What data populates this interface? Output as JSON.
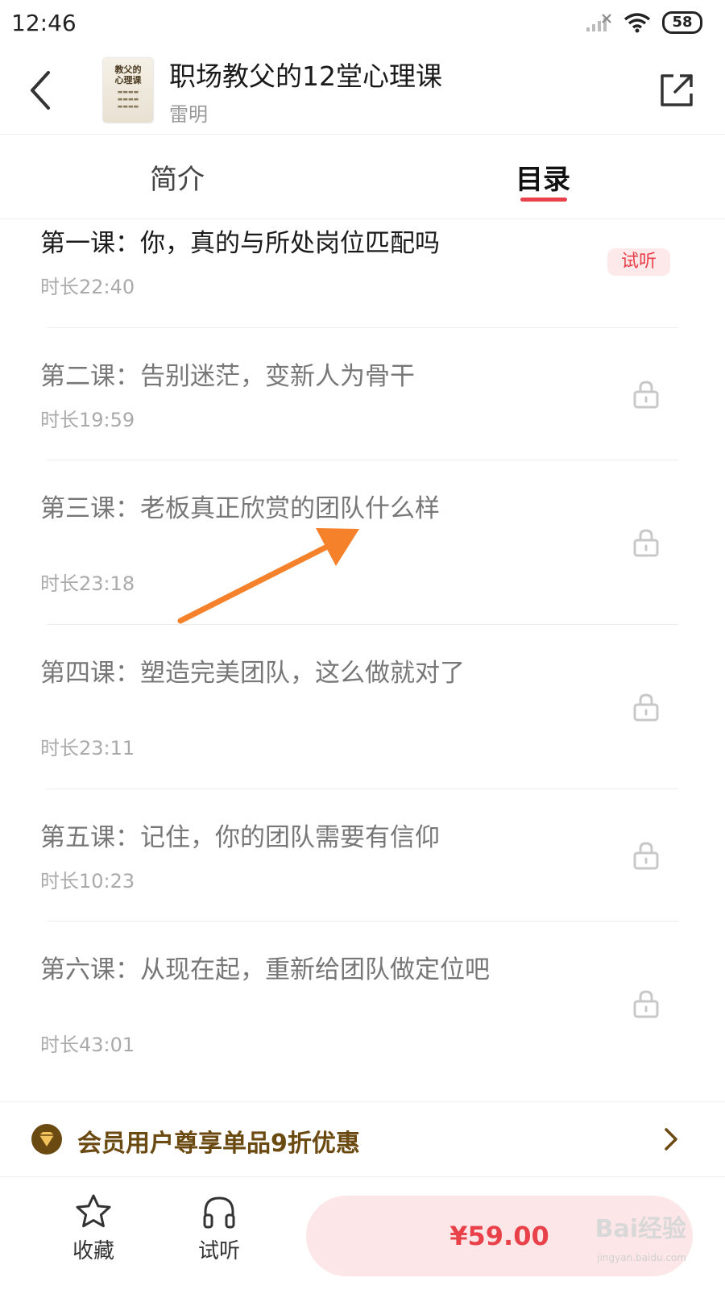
{
  "status_bar": {
    "time": "12:46",
    "battery": "58"
  },
  "header": {
    "title": "职场教父的12堂心理课",
    "author": "雷明",
    "cover_line1": "教父的",
    "cover_line2": "心理课"
  },
  "tabs": {
    "intro": "简介",
    "catalog": "目录",
    "active": "catalog"
  },
  "lessons": [
    {
      "title": "第一课：你，真的与所处岗位匹配吗",
      "duration": "时长22:40",
      "badge": "试听",
      "locked": false
    },
    {
      "title": "第二课：告别迷茫，变新人为骨干",
      "duration": "时长19:59",
      "locked": true
    },
    {
      "title": "第三课：老板真正欣赏的团队什么样",
      "duration": "时长23:18",
      "locked": true
    },
    {
      "title": "第四课：塑造完美团队，这么做就对了",
      "duration": "时长23:11",
      "locked": true
    },
    {
      "title": "第五课：记住，你的团队需要有信仰",
      "duration": "时长10:23",
      "locked": true
    },
    {
      "title": "第六课：从现在起，重新给团队做定位吧",
      "duration": "时长43:01",
      "locked": true
    }
  ],
  "member_bar": {
    "text": "会员用户尊享单品9折优惠"
  },
  "bottom_bar": {
    "favorite": "收藏",
    "trial": "试听",
    "price": "¥59.00"
  },
  "watermark": {
    "main": "Bai经验",
    "sub": "jingyan.baidu.com"
  },
  "colors": {
    "accent": "#e8414a",
    "member": "#6b4a12",
    "arrow": "#f5812b"
  }
}
